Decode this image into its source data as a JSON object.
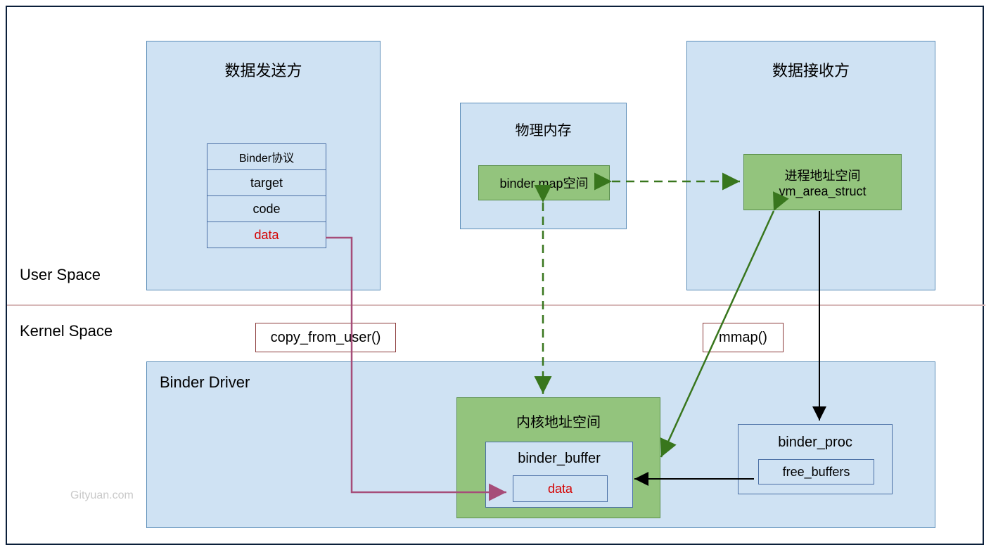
{
  "sender": {
    "title": "数据发送方",
    "cells": [
      "Binder协议",
      "target",
      "code",
      "data"
    ]
  },
  "physical_mem": {
    "title": "物理内存",
    "map_box": "binder map空间"
  },
  "receiver": {
    "title": "数据接收方",
    "addr_box_line1": "进程地址空间",
    "addr_box_line2": "vm_area_struct"
  },
  "space_labels": {
    "user": "User Space",
    "kernel": "Kernel Space"
  },
  "func_labels": {
    "copy": "copy_from_user()",
    "mmap": "mmap()"
  },
  "driver": {
    "title": "Binder Driver",
    "kernel_addr": "内核地址空间",
    "buffer": "binder_buffer",
    "data": "data",
    "proc": "binder_proc",
    "free": "free_buffers"
  },
  "watermark": "Gityuan.com",
  "colors": {
    "purple": "#a64d79",
    "green": "#38761d",
    "black": "#000000",
    "divider": "#bfa5a5"
  }
}
